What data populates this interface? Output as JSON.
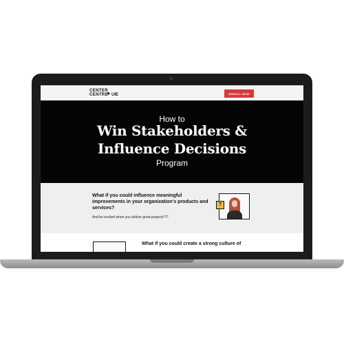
{
  "header": {
    "logo": {
      "line1": "CENTER",
      "line2": "CENTRE",
      "star": "✱",
      "brand": "UIE"
    },
    "cta_label": "ENROLL NOW"
  },
  "hero": {
    "pre_title": "How to",
    "title_line1": "Win Stakeholders &",
    "title_line2": "Influence Decisions",
    "post_title": "Program"
  },
  "section1": {
    "question": "What if you could influence meaningful improvements in your organization's products and services?",
    "subtext": "And be excited when you deliver great projects?!?",
    "badge": "?"
  },
  "section2": {
    "question": "What if you could create a strong culture of"
  },
  "colors": {
    "accent": "#d83a3a",
    "hero_bg": "#050505",
    "badge": "#e9b94a",
    "hair": "#b5523a"
  }
}
